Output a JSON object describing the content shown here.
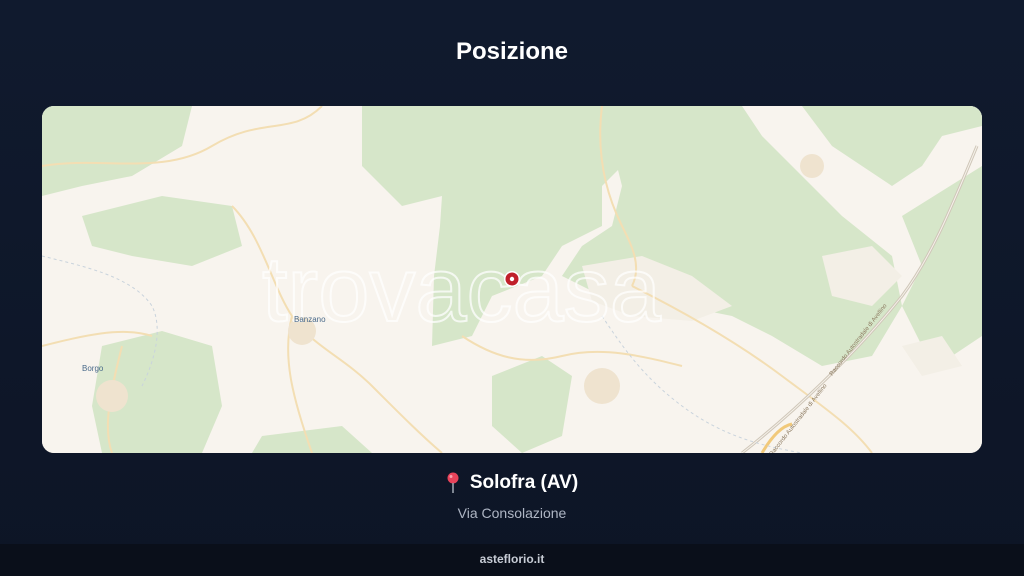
{
  "page": {
    "title": "Posizione"
  },
  "map": {
    "watermark": "trovacasa",
    "labels": {
      "banzano": "Banzano",
      "borgo": "Borgo",
      "road_1": "Raccordo Autostradale di Avellino",
      "road_2": "Raccordo Autostradale di Avellino"
    },
    "marker": "location-marker",
    "colors": {
      "land": "#f8f4ee",
      "forest": "#d9e8cd",
      "marker": "#c0202a"
    }
  },
  "location": {
    "city": "Solofra (AV)",
    "street": "Via Consolazione",
    "pin_icon": "pin-icon"
  },
  "footer": {
    "site": "asteflorio.it"
  }
}
